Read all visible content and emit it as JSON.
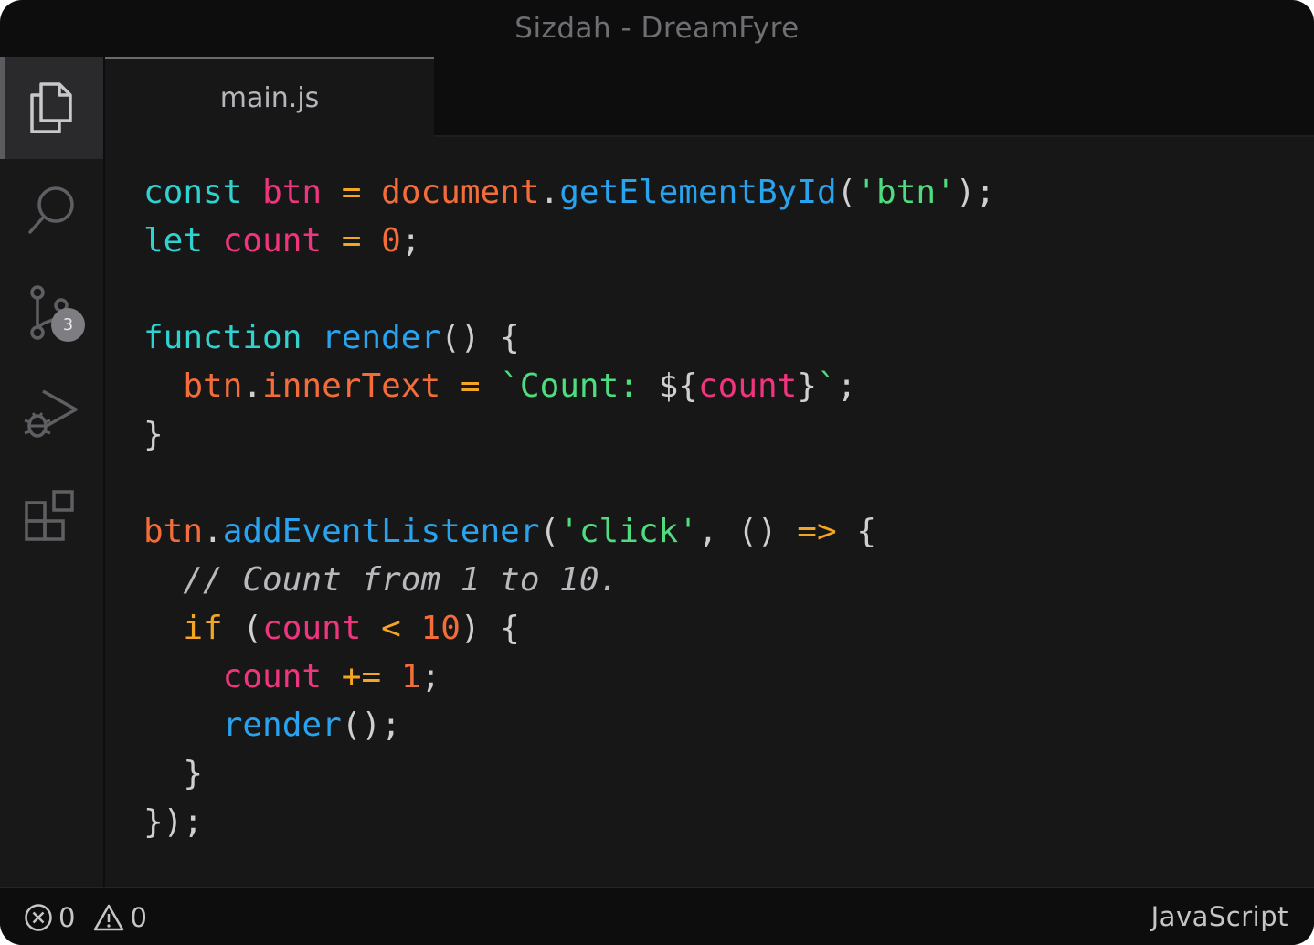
{
  "window": {
    "title": "Sizdah - DreamFyre"
  },
  "activity_bar": {
    "items": [
      {
        "icon": "files-icon",
        "active": true
      },
      {
        "icon": "search-icon",
        "active": false
      },
      {
        "icon": "source-control-icon",
        "active": false,
        "badge": "3"
      },
      {
        "icon": "run-debug-icon",
        "active": false
      },
      {
        "icon": "extensions-icon",
        "active": false
      }
    ]
  },
  "tabs": [
    {
      "label": "main.js",
      "active": true
    }
  ],
  "editor": {
    "language": "javascript",
    "lines": [
      [
        {
          "t": "const",
          "c": "k-cyan"
        },
        {
          "t": " ",
          "c": "k-text"
        },
        {
          "t": "btn",
          "c": "k-pink"
        },
        {
          "t": " ",
          "c": "k-text"
        },
        {
          "t": "=",
          "c": "k-yellow"
        },
        {
          "t": " ",
          "c": "k-text"
        },
        {
          "t": "document",
          "c": "k-orange"
        },
        {
          "t": ".",
          "c": "k-text"
        },
        {
          "t": "getElementById",
          "c": "k-blue"
        },
        {
          "t": "(",
          "c": "k-text"
        },
        {
          "t": "'btn'",
          "c": "k-green"
        },
        {
          "t": ");",
          "c": "k-text"
        }
      ],
      [
        {
          "t": "let",
          "c": "k-cyan"
        },
        {
          "t": " ",
          "c": "k-text"
        },
        {
          "t": "count",
          "c": "k-pink"
        },
        {
          "t": " ",
          "c": "k-text"
        },
        {
          "t": "=",
          "c": "k-yellow"
        },
        {
          "t": " ",
          "c": "k-text"
        },
        {
          "t": "0",
          "c": "k-orange"
        },
        {
          "t": ";",
          "c": "k-text"
        }
      ],
      [],
      [
        {
          "t": "function",
          "c": "k-cyan"
        },
        {
          "t": " ",
          "c": "k-text"
        },
        {
          "t": "render",
          "c": "k-blue"
        },
        {
          "t": "() {",
          "c": "k-text"
        }
      ],
      [
        {
          "t": "  ",
          "c": "k-text"
        },
        {
          "t": "btn",
          "c": "k-orange"
        },
        {
          "t": ".",
          "c": "k-text"
        },
        {
          "t": "innerText",
          "c": "k-orange"
        },
        {
          "t": " ",
          "c": "k-text"
        },
        {
          "t": "=",
          "c": "k-yellow"
        },
        {
          "t": " ",
          "c": "k-text"
        },
        {
          "t": "`Count: ",
          "c": "k-green"
        },
        {
          "t": "${",
          "c": "k-text"
        },
        {
          "t": "count",
          "c": "k-pink"
        },
        {
          "t": "}",
          "c": "k-text"
        },
        {
          "t": "`",
          "c": "k-green"
        },
        {
          "t": ";",
          "c": "k-text"
        }
      ],
      [
        {
          "t": "}",
          "c": "k-text"
        }
      ],
      [],
      [
        {
          "t": "btn",
          "c": "k-orange"
        },
        {
          "t": ".",
          "c": "k-text"
        },
        {
          "t": "addEventListener",
          "c": "k-blue"
        },
        {
          "t": "(",
          "c": "k-text"
        },
        {
          "t": "'click'",
          "c": "k-green"
        },
        {
          "t": ", () ",
          "c": "k-text"
        },
        {
          "t": "=>",
          "c": "k-yellow"
        },
        {
          "t": " {",
          "c": "k-text"
        }
      ],
      [
        {
          "t": "  ",
          "c": "k-text"
        },
        {
          "t": "// Count from 1 to 10.",
          "c": "k-comment"
        }
      ],
      [
        {
          "t": "  ",
          "c": "k-text"
        },
        {
          "t": "if",
          "c": "k-yellow"
        },
        {
          "t": " (",
          "c": "k-text"
        },
        {
          "t": "count",
          "c": "k-pink"
        },
        {
          "t": " ",
          "c": "k-text"
        },
        {
          "t": "<",
          "c": "k-yellow"
        },
        {
          "t": " ",
          "c": "k-text"
        },
        {
          "t": "10",
          "c": "k-orange"
        },
        {
          "t": ") {",
          "c": "k-text"
        }
      ],
      [
        {
          "t": "    ",
          "c": "k-text"
        },
        {
          "t": "count",
          "c": "k-pink"
        },
        {
          "t": " ",
          "c": "k-text"
        },
        {
          "t": "+=",
          "c": "k-yellow"
        },
        {
          "t": " ",
          "c": "k-text"
        },
        {
          "t": "1",
          "c": "k-orange"
        },
        {
          "t": ";",
          "c": "k-text"
        }
      ],
      [
        {
          "t": "    ",
          "c": "k-text"
        },
        {
          "t": "render",
          "c": "k-blue"
        },
        {
          "t": "();",
          "c": "k-text"
        }
      ],
      [
        {
          "t": "  }",
          "c": "k-text"
        }
      ],
      [
        {
          "t": "});",
          "c": "k-text"
        }
      ]
    ]
  },
  "status_bar": {
    "errors": "0",
    "warnings": "0",
    "language": "JavaScript"
  },
  "colors": {
    "keyword": "#2fd2cf",
    "variable": "#f0357f",
    "property": "#f26d3a",
    "function": "#2aa3ef",
    "string": "#4fdc7e",
    "operator": "#f5a524",
    "background": "#171718"
  }
}
